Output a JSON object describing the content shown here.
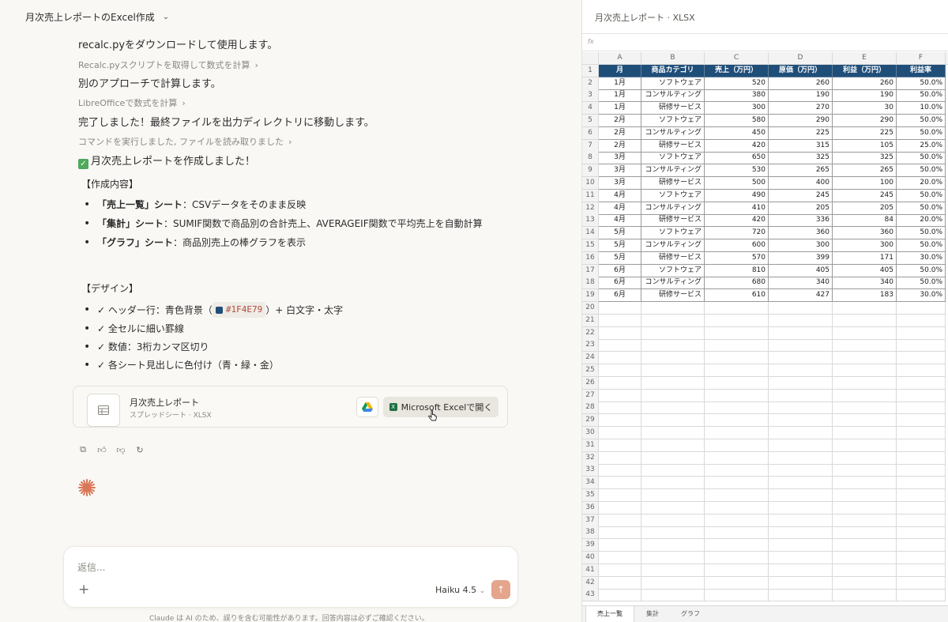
{
  "chat": {
    "title": "月次売上レポートのExcel作成",
    "lines": [
      "recalc.pyをダウンロードして使用します。",
      "Recalc.pyスクリプトを取得して数式を計算",
      "別のアプローチで計算します。",
      "LibreOfficeで数式を計算",
      "完了しました！最終ファイルを出力ディレクトリに移動します。",
      "コマンドを実行しました, ファイルを読み取りました"
    ],
    "done_check": "✓",
    "done_text": "月次売上レポートを作成しました！",
    "contents_heading": "【作成内容】",
    "contents": [
      {
        "bold": "「売上一覧」シート",
        "text": "：CSVデータをそのまま反映"
      },
      {
        "bold": "「集計」シート",
        "text": "：SUMIF関数で商品別の合計売上、AVERAGEIF関数で平均売上を自動計算"
      },
      {
        "bold": "「グラフ」シート",
        "text": "：商品別売上の棒グラフを表示"
      }
    ],
    "design_heading": "【デザイン】",
    "design": {
      "header_pre": "✓ ヘッダー行：青色背景（",
      "header_hex": "#1F4E79",
      "header_post": "）+ 白文字・太字",
      "items": [
        "✓ 全セルに細い罫線",
        "✓ 数値：3桁カンマ区切り",
        "✓ 各シート見出しに色付け（青・緑・金）"
      ]
    },
    "file_card": {
      "name": "月次売上レポート",
      "meta": "スプレッドシート · XLSX",
      "open_label": "Microsoft Excelで開く"
    },
    "composer": {
      "placeholder": "返信...",
      "model": "Haiku 4.5"
    },
    "disclaimer": "Claude は AI のため、誤りを含む可能性があります。回答内容は必ずご確認ください。"
  },
  "sheet": {
    "title": "月次売上レポート · XLSX",
    "fx_label": "fx",
    "col_letters": [
      "A",
      "B",
      "C",
      "D",
      "E",
      "F"
    ],
    "headers": [
      "月",
      "商品カテゴリ",
      "売上（万円）",
      "原価（万円）",
      "利益（万円）",
      "利益率"
    ],
    "rows": [
      [
        "1月",
        "ソフトウェア",
        "520",
        "260",
        "260",
        "50.0%"
      ],
      [
        "1月",
        "コンサルティング",
        "380",
        "190",
        "190",
        "50.0%"
      ],
      [
        "1月",
        "研修サービス",
        "300",
        "270",
        "30",
        "10.0%"
      ],
      [
        "2月",
        "ソフトウェア",
        "580",
        "290",
        "290",
        "50.0%"
      ],
      [
        "2月",
        "コンサルティング",
        "450",
        "225",
        "225",
        "50.0%"
      ],
      [
        "2月",
        "研修サービス",
        "420",
        "315",
        "105",
        "25.0%"
      ],
      [
        "3月",
        "ソフトウェア",
        "650",
        "325",
        "325",
        "50.0%"
      ],
      [
        "3月",
        "コンサルティング",
        "530",
        "265",
        "265",
        "50.0%"
      ],
      [
        "3月",
        "研修サービス",
        "500",
        "400",
        "100",
        "20.0%"
      ],
      [
        "4月",
        "ソフトウェア",
        "490",
        "245",
        "245",
        "50.0%"
      ],
      [
        "4月",
        "コンサルティング",
        "410",
        "205",
        "205",
        "50.0%"
      ],
      [
        "4月",
        "研修サービス",
        "420",
        "336",
        "84",
        "20.0%"
      ],
      [
        "5月",
        "ソフトウェア",
        "720",
        "360",
        "360",
        "50.0%"
      ],
      [
        "5月",
        "コンサルティング",
        "600",
        "300",
        "300",
        "50.0%"
      ],
      [
        "5月",
        "研修サービス",
        "570",
        "399",
        "171",
        "30.0%"
      ],
      [
        "6月",
        "ソフトウェア",
        "810",
        "405",
        "405",
        "50.0%"
      ],
      [
        "6月",
        "コンサルティング",
        "680",
        "340",
        "340",
        "50.0%"
      ],
      [
        "6月",
        "研修サービス",
        "610",
        "427",
        "183",
        "30.0%"
      ]
    ],
    "row_numbers": [
      "1",
      "2",
      "3",
      "4",
      "5",
      "6",
      "7",
      "8",
      "9",
      "10",
      "11",
      "12",
      "13",
      "14",
      "15",
      "16",
      "17",
      "18",
      "19",
      "20",
      "21",
      "22",
      "23",
      "24",
      "25",
      "26",
      "27",
      "28",
      "29",
      "30",
      "31",
      "32",
      "33",
      "34",
      "35",
      "36",
      "37",
      "38",
      "39",
      "40",
      "41",
      "42",
      "43"
    ],
    "tabs": [
      "売上一覧",
      "集計",
      "グラフ"
    ],
    "active_tab": "売上一覧",
    "header_fill": "#1F4E79"
  }
}
